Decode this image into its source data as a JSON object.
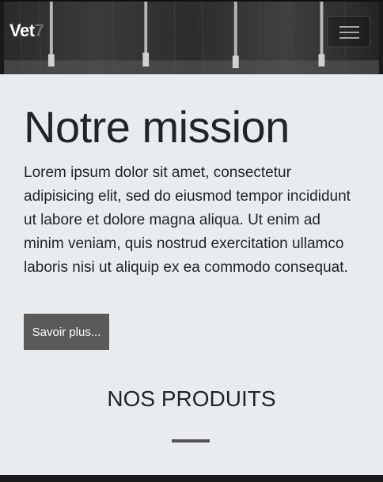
{
  "navbar": {
    "brand_main": "Vet",
    "brand_accent": "7",
    "menu_icon": "hamburger-icon"
  },
  "mission": {
    "title": "Notre mission",
    "text": "Lorem ipsum dolor sit amet, consectetur adipisicing elit, sed do eiusmod tempor incididunt ut labore et dolore magna aliqua. Ut enim ad minim veniam, quis nostrud exercitation ullamco laboris nisi ut aliquip ex ea commodo consequat.",
    "button_label": "Savoir plus..."
  },
  "products": {
    "title": "NOS PRODUITS"
  },
  "colors": {
    "background": "#e9ecef",
    "button": "#5a5a5a",
    "navbar": "#1a1a1a"
  }
}
